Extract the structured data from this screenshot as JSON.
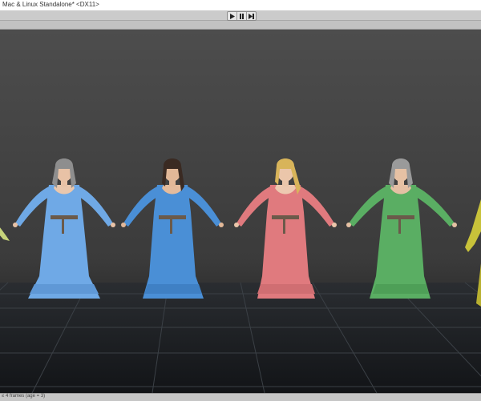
{
  "window": {
    "title": "Mac & Linux Standalone* <DX11>"
  },
  "toolbar": {
    "play_icon": "play-icon",
    "pause_icon": "pause-icon",
    "step_icon": "step-icon"
  },
  "scene": {
    "description_icon": "game-viewport",
    "characters": [
      {
        "name": "character-blue-gray-hair",
        "dress_color": "#6fa9e6",
        "hair_color": "#8e8e8e"
      },
      {
        "name": "character-blue-dark-hair",
        "dress_color": "#4a8fd6",
        "hair_color": "#3a2a22"
      },
      {
        "name": "character-pink-blonde-hair",
        "dress_color": "#e07a7e",
        "hair_color": "#d8b45a"
      },
      {
        "name": "character-green-gray-hair",
        "dress_color": "#5aae63",
        "hair_color": "#9a9a9a"
      }
    ],
    "sky_color": "#4a4a4a",
    "floor_color": "#1c1f23"
  },
  "statusbar": {
    "text": "≤ 4 frames (age = 3)"
  }
}
